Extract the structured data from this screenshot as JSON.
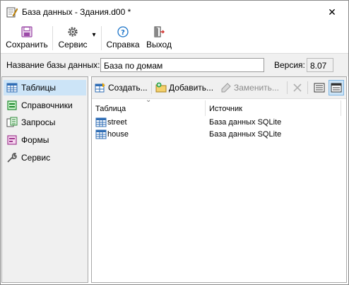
{
  "window": {
    "title": "База данных - Здания.d00 *",
    "close_glyph": "✕"
  },
  "toolbar": {
    "save_label": "Сохранить",
    "service_label": "Сервис",
    "help_label": "Справка",
    "exit_label": "Выход",
    "service_dropdown_glyph": "▾"
  },
  "db": {
    "name_label": "Название базы данных:",
    "name_value": "База по домам",
    "version_label": "Версия:",
    "version_value": "8.07"
  },
  "sidebar": {
    "items": [
      {
        "label": "Таблицы",
        "icon": "table-icon",
        "active": true
      },
      {
        "label": "Справочники",
        "icon": "reference-book-icon",
        "active": false
      },
      {
        "label": "Запросы",
        "icon": "query-icon",
        "active": false
      },
      {
        "label": "Формы",
        "icon": "form-icon",
        "active": false
      },
      {
        "label": "Сервис",
        "icon": "wrench-icon",
        "active": false
      }
    ]
  },
  "main": {
    "create_label": "Создать...",
    "add_label": "Добавить...",
    "replace_label": "Заменить...",
    "sort_glyph": "⌄",
    "columns": {
      "table": "Таблица",
      "source": "Источник"
    },
    "rows": [
      {
        "name": "street",
        "source": "База данных SQLite"
      },
      {
        "name": "house",
        "source": "База данных SQLite"
      }
    ]
  },
  "colors": {
    "accent_selected": "#cce4f7",
    "panel_bg": "#f0f0f0"
  }
}
